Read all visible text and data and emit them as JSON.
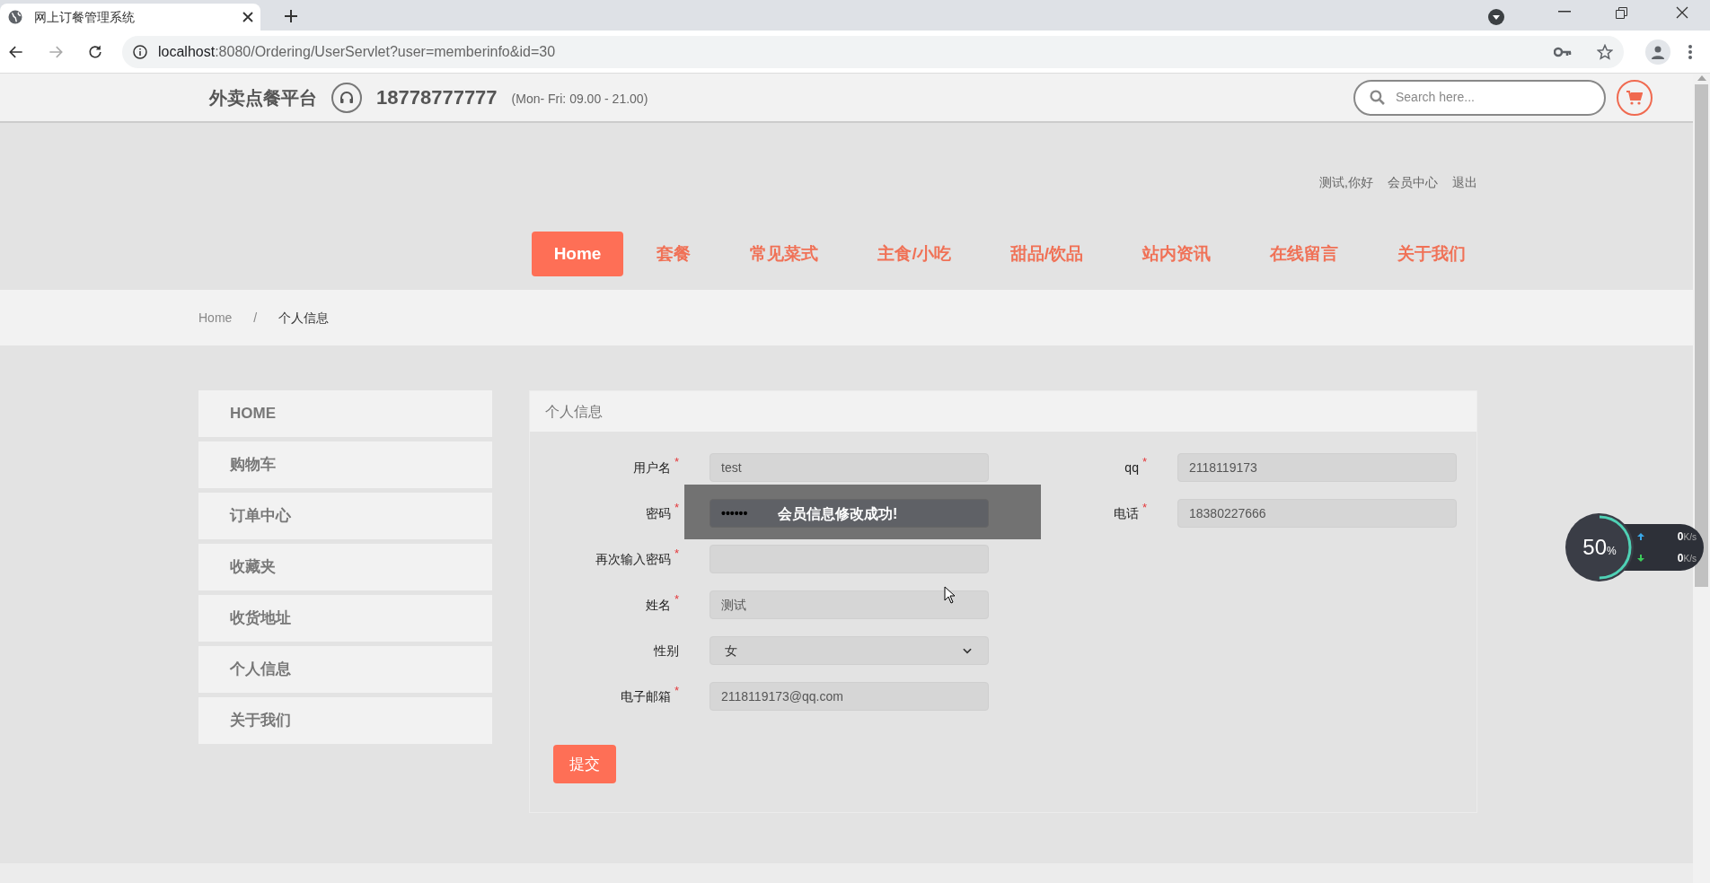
{
  "browser": {
    "tab_title": "网上订餐管理系统",
    "url_host": "localhost",
    "url_rest": ":8080/Ordering/UserServlet?user=memberinfo&id=30"
  },
  "header": {
    "brand": "外卖点餐平台",
    "phone": "18778777777",
    "hours": "(Mon- Fri: 09.00 - 21.00)",
    "search": {
      "placeholder": "Search here..."
    }
  },
  "user_links": [
    "测试,你好",
    "会员中心",
    "退出"
  ],
  "nav": [
    {
      "label": "Home",
      "selected": true
    },
    {
      "label": "套餐",
      "selected": false
    },
    {
      "label": "常见菜式",
      "selected": false
    },
    {
      "label": "主食/小吃",
      "selected": false
    },
    {
      "label": "甜品/饮品",
      "selected": false
    },
    {
      "label": "站内资讯",
      "selected": false
    },
    {
      "label": "在线留言",
      "selected": false
    },
    {
      "label": "关于我们",
      "selected": false
    }
  ],
  "breadcrumb": [
    "Home",
    "/",
    "个人信息"
  ],
  "sidebar": {
    "items": [
      {
        "label": "HOME"
      },
      {
        "label": "购物车"
      },
      {
        "label": "订单中心"
      },
      {
        "label": "收藏夹"
      },
      {
        "label": "收货地址"
      },
      {
        "label": "个人信息"
      },
      {
        "label": "关于我们"
      }
    ]
  },
  "form": {
    "title": "个人信息",
    "left": [
      {
        "label": "用户名",
        "mark": "*",
        "kind": "text",
        "value": "test"
      },
      {
        "label": "密码",
        "mark": "*",
        "kind": "password",
        "value": "••••••"
      },
      {
        "label": "再次输入密码",
        "mark": "*",
        "kind": "text"
      },
      {
        "label": "姓名",
        "mark": "*",
        "kind": "text",
        "value": "测试"
      },
      {
        "label": "性别",
        "kind": "select",
        "value": "女"
      },
      {
        "label": "电子邮箱",
        "mark": "*",
        "kind": "text",
        "value": "2118119173@qq.com"
      }
    ],
    "right": [
      {
        "label": "qq",
        "mark": "*",
        "kind": "text",
        "value": "2118119173"
      },
      {
        "label": "电话",
        "mark": "*",
        "kind": "text",
        "value": "18380227666"
      }
    ],
    "submit": "提交"
  },
  "toast": "会员信息修改成功!",
  "net_widget": {
    "percent": "50",
    "unit": "%",
    "level": 0.5,
    "up": "0",
    "down": "0",
    "rate_unit_up": "K/s",
    "rate_unit_down": "K/s"
  }
}
